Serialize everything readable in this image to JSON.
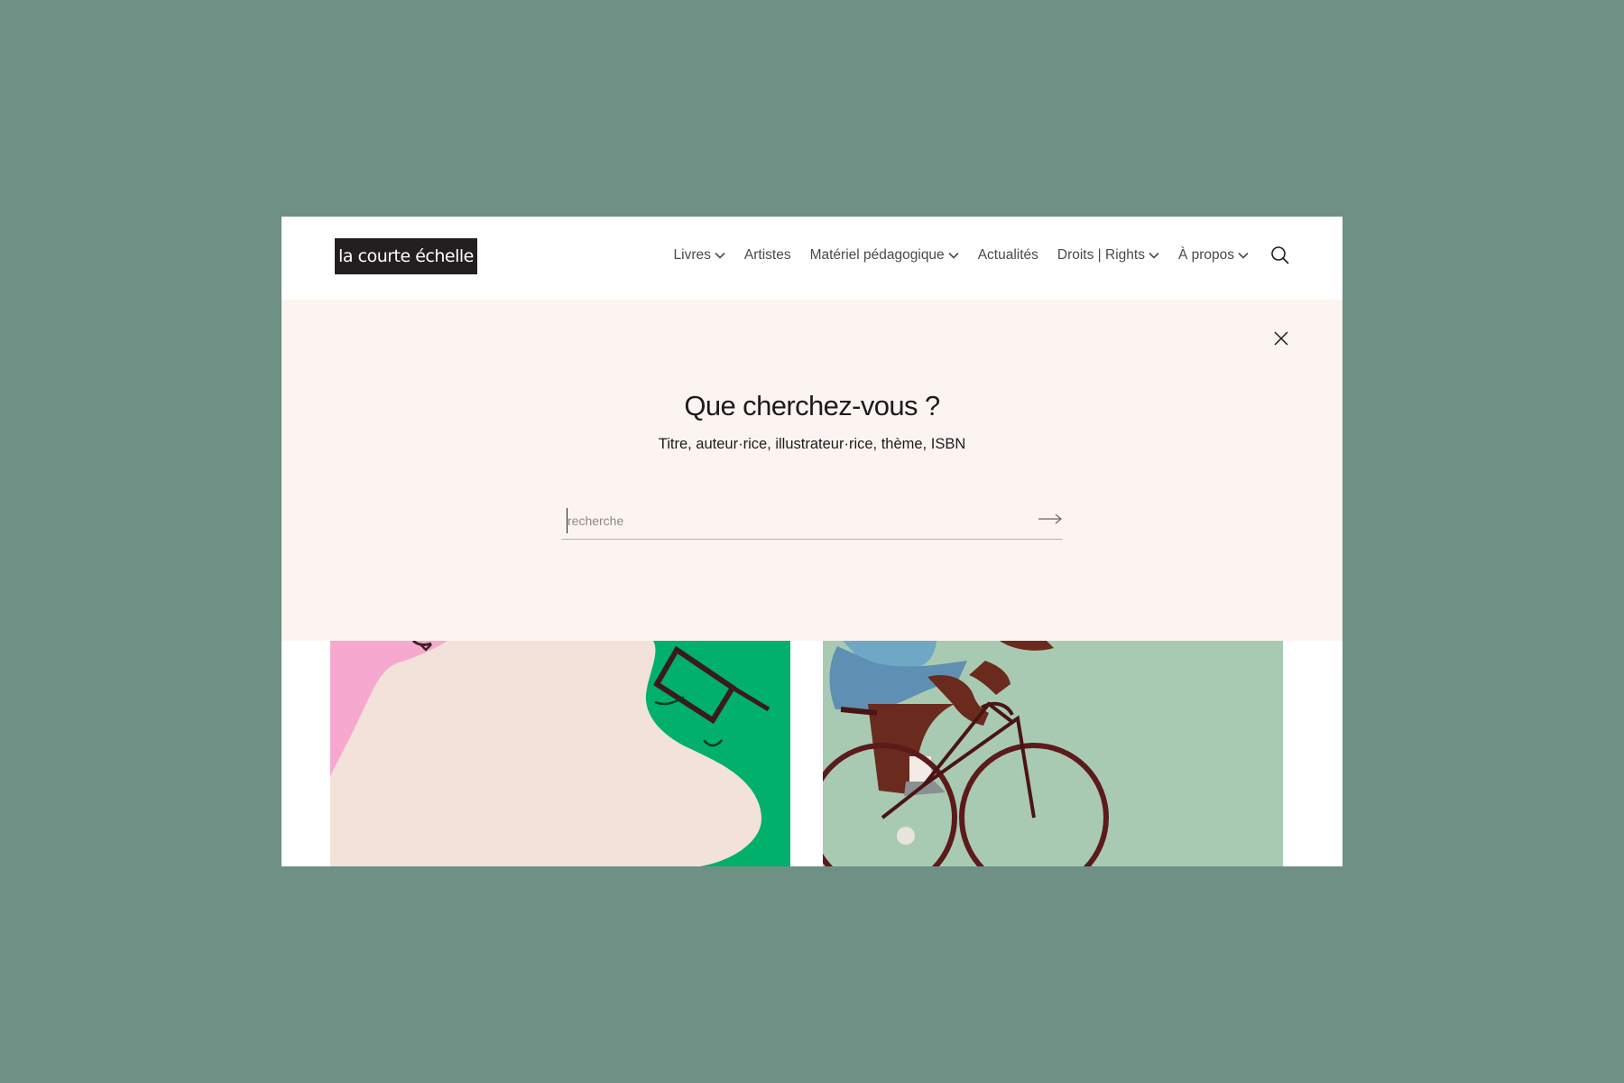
{
  "brand": {
    "logo_text": "la courte échelle"
  },
  "nav": {
    "items": [
      {
        "label": "Livres",
        "dropdown": true
      },
      {
        "label": "Artistes",
        "dropdown": false
      },
      {
        "label": "Matériel pédagogique",
        "dropdown": true
      },
      {
        "label": "Actualités",
        "dropdown": false
      },
      {
        "label": "Droits | Rights",
        "dropdown": true
      },
      {
        "label": "À propos",
        "dropdown": true
      }
    ],
    "search_icon": "search-icon"
  },
  "search": {
    "heading": "Que cherchez-vous ?",
    "subheading": "Titre, auteur·rice, illustrateur·rice, thème, ISBN",
    "placeholder": "recherche",
    "value": "",
    "close_icon": "close-icon",
    "submit_icon": "arrow-right-icon"
  },
  "colors": {
    "page_background": "#6e9085",
    "overlay_background": "#fcf4f1",
    "logo_background": "#231f20",
    "illustration_left_bg": "#f2e2d9",
    "illustration_pink": "#f7a8cf",
    "illustration_green": "#00b06b",
    "illustration_right_bg": "#a9cab2",
    "illustration_maroon": "#6b2020"
  }
}
